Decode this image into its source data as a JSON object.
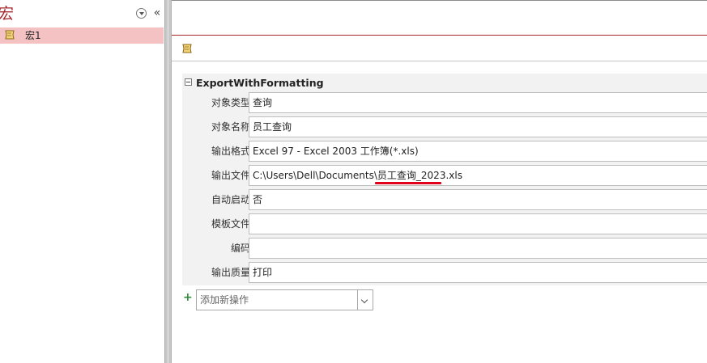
{
  "nav": {
    "title": "宏",
    "items": [
      {
        "label": "宏1",
        "icon": "macro-icon",
        "selected": true
      }
    ]
  },
  "action": {
    "name": "ExportWithFormatting",
    "arguments": [
      {
        "label": "对象类型",
        "value": "查询"
      },
      {
        "label": "对象名称",
        "value": "员工查询"
      },
      {
        "label": "输出格式",
        "value": "Excel 97 - Excel 2003 工作簿(*.xls)"
      },
      {
        "label": "输出文件",
        "value": "C:\\Users\\Dell\\Documents\\员工查询_2023.xls"
      },
      {
        "label": "自动启动",
        "value": "否"
      },
      {
        "label": "模板文件",
        "value": ""
      },
      {
        "label": "编码",
        "value": ""
      },
      {
        "label": "输出质量",
        "value": "打印"
      }
    ]
  },
  "add_action": {
    "placeholder": "添加新操作"
  },
  "colors": {
    "accent": "#a4262c",
    "selection": "#f5c2c4",
    "annotation": "#e0001b"
  }
}
